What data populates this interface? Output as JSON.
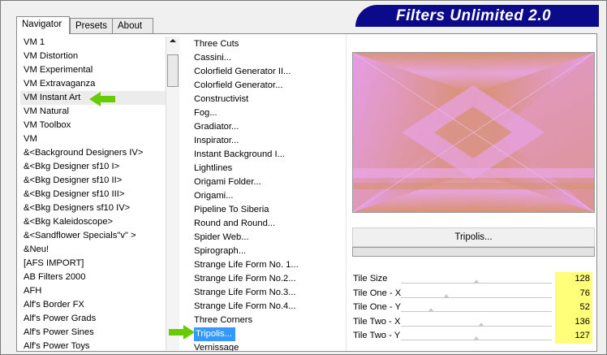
{
  "app": {
    "title": "Filters Unlimited 2.0"
  },
  "tabs": [
    {
      "label": "Navigator"
    },
    {
      "label": "Presets"
    },
    {
      "label": "About"
    }
  ],
  "categories": [
    "VM 1",
    "VM Distortion",
    "VM Experimental",
    "VM Extravaganza",
    "VM Instant Art",
    "VM Natural",
    "VM Toolbox",
    "VM",
    "&<Background Designers IV>",
    "&<Bkg Designer sf10 I>",
    "&<Bkg Designer sf10 II>",
    "&<Bkg Designer sf10 III>",
    "&<Bkg Designers sf10 IV>",
    "&<Bkg Kaleidoscope>",
    "&<Sandflower Specials\"v\" >",
    "&Neu!",
    "[AFS IMPORT]",
    "AB Filters 2000",
    "AFH",
    "Alf's Border FX",
    "Alf's Power Grads",
    "Alf's Power Sines",
    "Alf's Power Toys"
  ],
  "selected_category": "VM Instant Art",
  "filters": [
    "Three Cuts",
    "Cassini...",
    "Colorfield Generator II...",
    "Colorfield Generator...",
    "Constructivist",
    "Fog...",
    "Gradiator...",
    "Inspirator...",
    "Instant Background I...",
    "Lightlines",
    "Origami Folder...",
    "Origami...",
    "Pipeline To Siberia",
    "Round and Round...",
    "Spider Web...",
    "Spirograph...",
    "Strange Life Form No. 1...",
    "Strange Life Form No.2...",
    "Strange Life Form No.3...",
    "Strange Life Form No.4...",
    "Three Corners",
    "Tripolis...",
    "Vernissage"
  ],
  "selected_filter": "Tripolis...",
  "filter_button": {
    "label": "Tripolis..."
  },
  "params": [
    {
      "label": "Tile Size",
      "value": "128",
      "level": 0.5
    },
    {
      "label": "Tile One - X",
      "value": "76",
      "level": 0.3
    },
    {
      "label": "Tile One - Y",
      "value": "52",
      "level": 0.2
    },
    {
      "label": "Tile Two - X",
      "value": "136",
      "level": 0.53
    },
    {
      "label": "Tile Two - Y",
      "value": "127",
      "level": 0.5
    }
  ],
  "colors": {
    "banner": "#0a0a8a",
    "highlight_value": "#ffff7a",
    "selection": "#3399ff",
    "arrow": "#66cc00",
    "preview_pink": "#e69be8",
    "preview_tan": "#d9916e"
  },
  "icons": {
    "pointer": "green-arrow-icon"
  }
}
